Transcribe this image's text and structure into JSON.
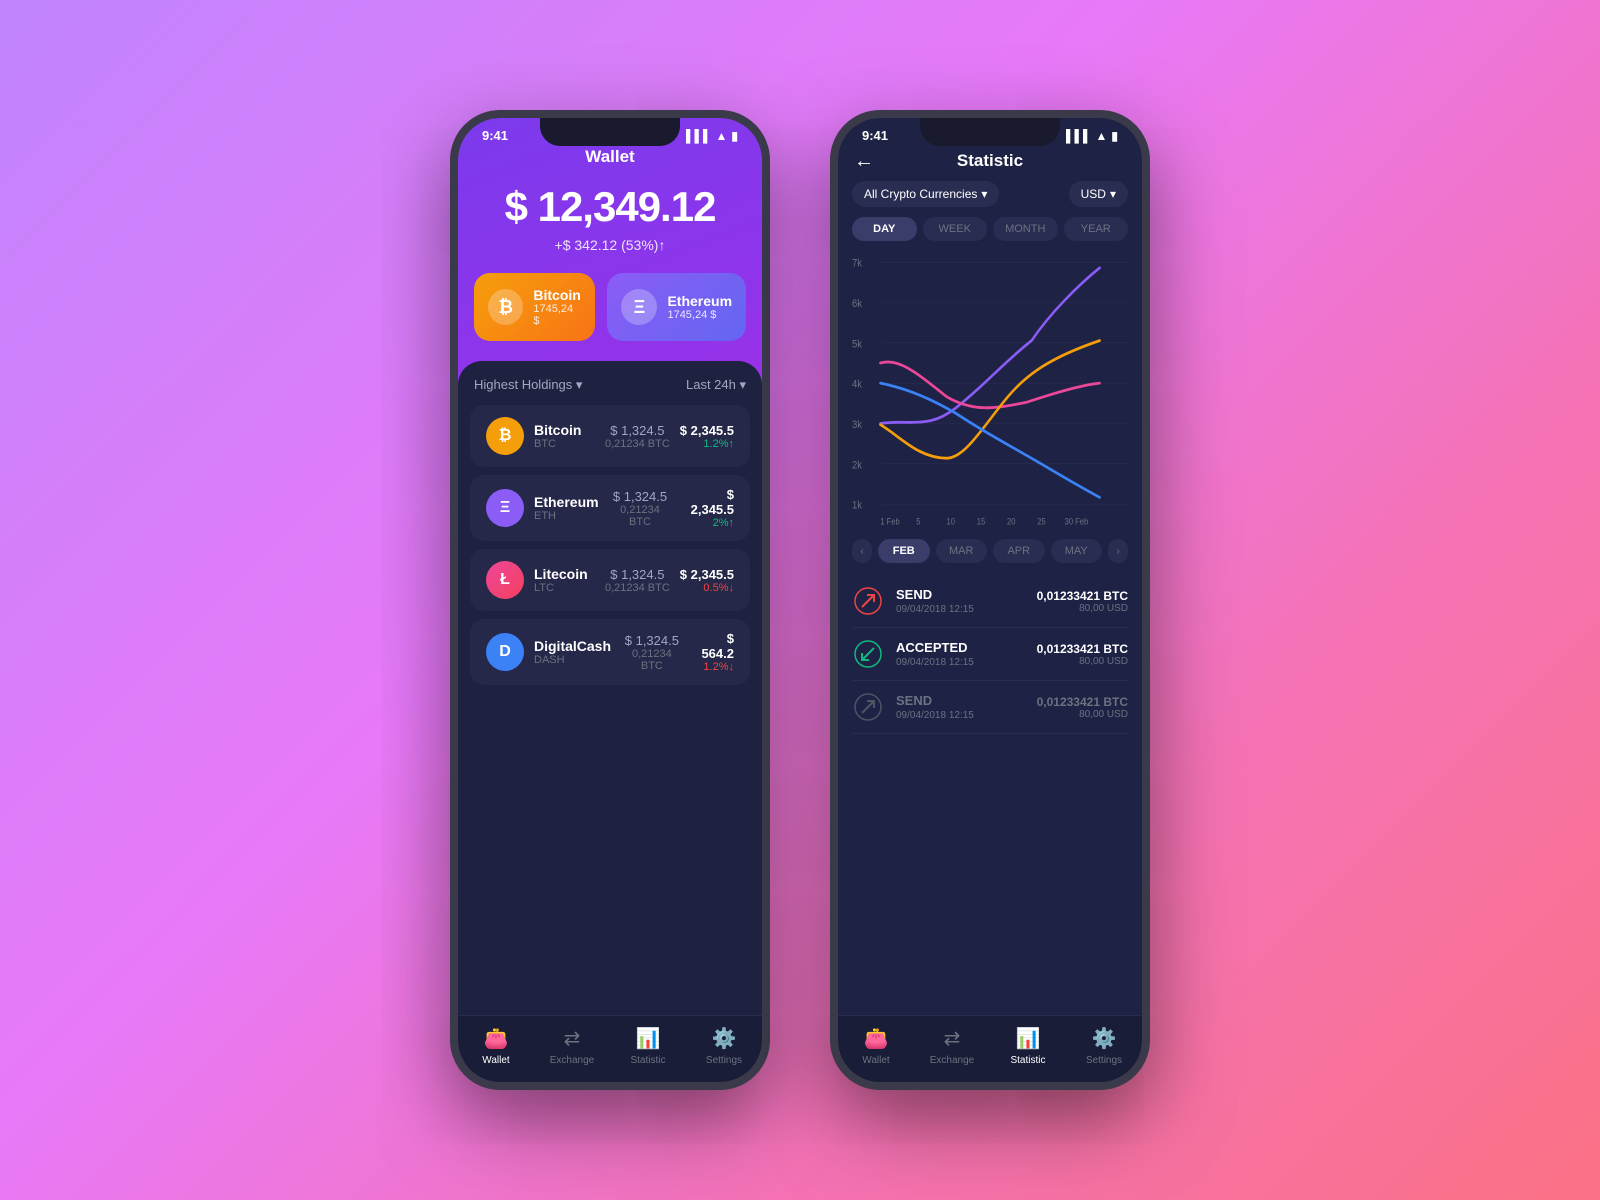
{
  "background": {
    "gradient": "linear-gradient(135deg, #c084fc 0%, #e879f9 40%, #f472b6 70%, #fb7185 100%)"
  },
  "phone1": {
    "status_time": "9:41",
    "screen_title": "Wallet",
    "balance": "$ 12,349.12",
    "change": "+$ 342.12 (53%)↑",
    "cards": [
      {
        "name": "Bitcoin",
        "amount": "1745,24 $",
        "icon": "₿",
        "color": "btc"
      },
      {
        "name": "Ethereum",
        "amount": "1745,24 $",
        "icon": "Ξ",
        "color": "eth"
      }
    ],
    "holdings_label": "Highest Holdings ▾",
    "period_label": "Last 24h ▾",
    "holdings": [
      {
        "name": "Bitcoin",
        "ticker": "BTC",
        "icon": "₿",
        "icon_bg": "#f59e0b",
        "price": "$ 1,324.5",
        "btc": "0,21234 BTC",
        "value": "$ 2,345.5",
        "change": "1.2%↑",
        "change_dir": "up"
      },
      {
        "name": "Ethereum",
        "ticker": "ETH",
        "icon": "Ξ",
        "icon_bg": "#8b5cf6",
        "price": "$ 1,324.5",
        "btc": "0,21234 BTC",
        "value": "$ 2,345.5",
        "change": "2%↑",
        "change_dir": "up"
      },
      {
        "name": "Litecoin",
        "ticker": "LTC",
        "icon": "Ł",
        "icon_bg": "#6b7280",
        "price": "$ 1,324.5",
        "btc": "0,21234 BTC",
        "value": "$ 2,345.5",
        "change": "0.5%↓",
        "change_dir": "down"
      },
      {
        "name": "DigitalCash",
        "ticker": "DASH",
        "icon": "D",
        "icon_bg": "#3b82f6",
        "price": "$ 1,324.5",
        "btc": "0,21234 BTC",
        "value": "$ 564.2",
        "change": "1.2%↓",
        "change_dir": "down"
      }
    ],
    "nav": [
      {
        "label": "Wallet",
        "icon": "👛",
        "active": true
      },
      {
        "label": "Exchange",
        "icon": "⇄",
        "active": false
      },
      {
        "label": "Statistic",
        "icon": "📊",
        "active": false
      },
      {
        "label": "Settings",
        "icon": "⚙️",
        "active": false
      }
    ]
  },
  "phone2": {
    "status_time": "9:41",
    "screen_title": "Statistic",
    "back_label": "←",
    "currency_filter": "All Crypto Currencies",
    "currency_unit": "USD",
    "period_tabs": [
      {
        "label": "DAY",
        "active": true
      },
      {
        "label": "WEEK",
        "active": false
      },
      {
        "label": "MONTH",
        "active": false
      },
      {
        "label": "YEAR",
        "active": false
      }
    ],
    "chart": {
      "y_labels": [
        "7k",
        "6k",
        "5k",
        "4k",
        "3k",
        "2k",
        "1k"
      ],
      "x_labels": [
        "1 Feb",
        "5",
        "10",
        "15",
        "20",
        "25",
        "30 Feb"
      ],
      "lines": [
        {
          "color": "#8b5cf6",
          "name": "purple"
        },
        {
          "color": "#ec4899",
          "name": "pink"
        },
        {
          "color": "#f59e0b",
          "name": "orange"
        },
        {
          "color": "#3b82f6",
          "name": "blue"
        }
      ]
    },
    "month_tabs": [
      {
        "label": "FEB",
        "active": true
      },
      {
        "label": "MAR",
        "active": false
      },
      {
        "label": "APR",
        "active": false
      },
      {
        "label": "MAY",
        "active": false
      }
    ],
    "transactions": [
      {
        "type": "SEND",
        "date": "09/04/2018 12:15",
        "btc": "0,01233421 BTC",
        "usd": "80,00 USD",
        "dir": "send",
        "dimmed": false
      },
      {
        "type": "ACCEPTED",
        "date": "09/04/2018 12:15",
        "btc": "0,01233421 BTC",
        "usd": "80,00 USD",
        "dir": "accept",
        "dimmed": false
      },
      {
        "type": "SEND",
        "date": "09/04/2018 12:15",
        "btc": "0,01233421 BTC",
        "usd": "80,00 USD",
        "dir": "send",
        "dimmed": true
      }
    ],
    "nav": [
      {
        "label": "Wallet",
        "icon": "👛",
        "active": false
      },
      {
        "label": "Exchange",
        "icon": "⇄",
        "active": false
      },
      {
        "label": "Statistic",
        "icon": "📊",
        "active": true
      },
      {
        "label": "Settings",
        "icon": "⚙️",
        "active": false
      }
    ]
  }
}
